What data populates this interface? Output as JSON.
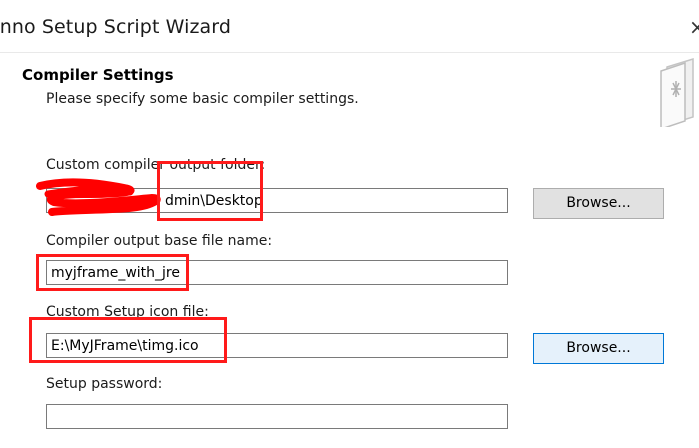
{
  "window": {
    "title": "Inno Setup Script Wizard",
    "close_glyph": "×"
  },
  "page": {
    "heading": "Compiler Settings",
    "subheading": "Please specify some basic compiler settings."
  },
  "fields": {
    "output_folder": {
      "label": "Custom compiler output folder:",
      "value": "dmin\\Desktop",
      "browse_label": "Browse..."
    },
    "base_file_name": {
      "label": "Compiler output base file name:",
      "value": "myjframe_with_jre"
    },
    "setup_icon": {
      "label": "Custom Setup icon file:",
      "value": "E:\\MyJFrame\\timg.ico",
      "browse_label": "Browse..."
    },
    "setup_password": {
      "label": "Setup password:",
      "value": ""
    }
  },
  "colors": {
    "annotation": "#ff1a1a",
    "redaction": "#ff0000",
    "focused_button": "#0078d7"
  }
}
